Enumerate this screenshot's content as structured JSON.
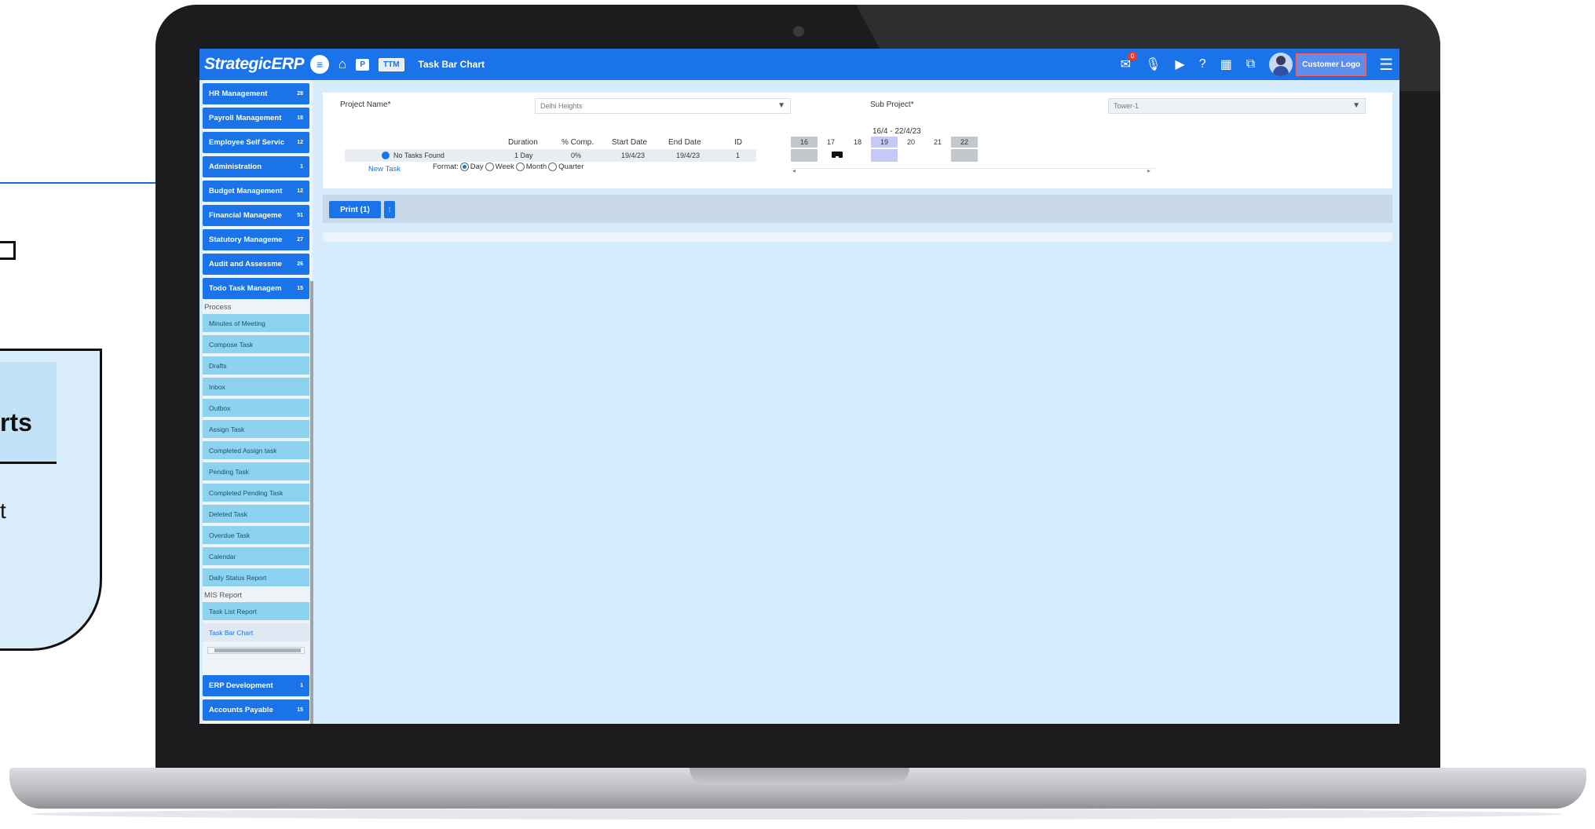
{
  "deco": {
    "card_title": "rts",
    "card_sub": "t"
  },
  "topbar": {
    "brand": "StrategicERP",
    "p_badge": "P",
    "ttm_badge": "TTM",
    "page_title": "Task Bar Chart",
    "mail_badge": "0",
    "customer_logo": "Customer Logo",
    "icons": [
      "menu-circle-icon",
      "home-icon",
      "mail-icon",
      "mic-icon",
      "youtube-icon",
      "help-icon",
      "calculator-icon",
      "copy-icon",
      "hamburger-icon"
    ]
  },
  "sidebar": {
    "modules_top": [
      {
        "label": "HR Management",
        "count": "28"
      },
      {
        "label": "Payroll Management",
        "count": "18"
      },
      {
        "label": "Employee Self Servic",
        "count": "12"
      },
      {
        "label": "Administration",
        "count": "1"
      },
      {
        "label": "Budget Management",
        "count": "12"
      },
      {
        "label": "Financial Manageme",
        "count": "51"
      },
      {
        "label": "Statutory Manageme",
        "count": "27"
      },
      {
        "label": "Audit and Assessme",
        "count": "26"
      },
      {
        "label": "Todo Task Managem",
        "count": "15"
      }
    ],
    "process_label": "Process",
    "process_items": [
      "Minutes of Meeting",
      "Compose Task",
      "Drafts",
      "Inbox",
      "Outbox",
      "Assign Task",
      "Completed Assign task",
      "Pending Task",
      "Completed Pending Task",
      "Deleted Task",
      "Overdue Task",
      "Calendar",
      "Daily Status Report"
    ],
    "mis_label": "MIS Report",
    "mis_items": [
      "Task List Report",
      "Task Bar Chart"
    ],
    "modules_bottom": [
      {
        "label": "ERP Development",
        "count": "1"
      },
      {
        "label": "Accounts Payable",
        "count": "15"
      }
    ]
  },
  "filters": {
    "project_label": "Project Name*",
    "project_value": "Delhi Heights",
    "subproject_label": "Sub Project*",
    "subproject_value": "Tower-1"
  },
  "task_grid": {
    "headers": {
      "duration": "Duration",
      "comp": "% Comp.",
      "start": "Start Date",
      "end": "End Date",
      "id": "ID"
    },
    "row": {
      "name": "No Tasks Found",
      "duration": "1 Day",
      "comp": "0%",
      "start": "19/4/23",
      "end": "19/4/23",
      "id": "1"
    },
    "new_task": "New Task",
    "format_label": "Format:",
    "format_options": [
      "Day",
      "Week",
      "Month",
      "Quarter"
    ],
    "format_selected": "Day"
  },
  "gantt": {
    "range": "16/4 - 22/4/23",
    "days": [
      "16",
      "17",
      "18",
      "19",
      "20",
      "21",
      "22"
    ]
  },
  "toolbar": {
    "print_label": "Print (1)",
    "split_label": "⁝"
  }
}
